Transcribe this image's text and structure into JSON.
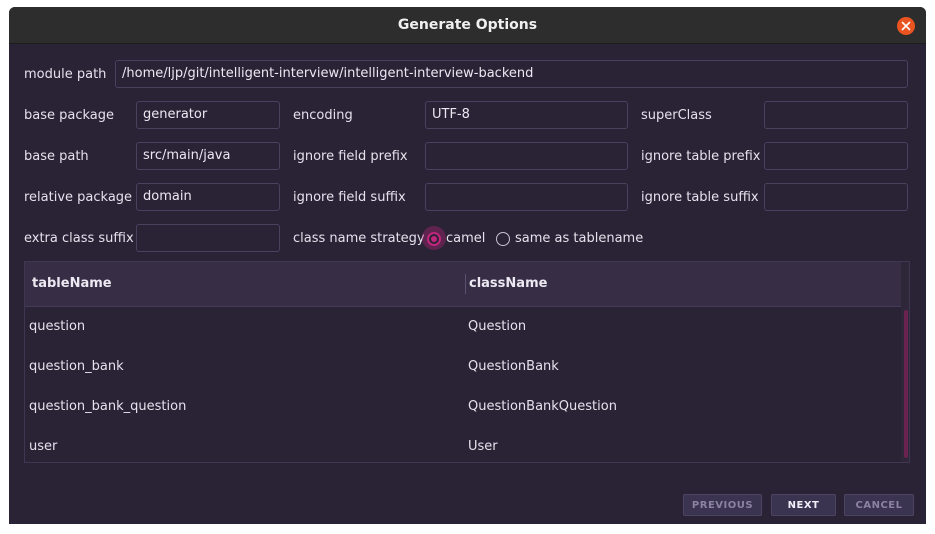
{
  "window": {
    "title": "Generate Options",
    "close_icon": "close-icon",
    "accent": "#e95420"
  },
  "form": {
    "module_path_label": "module path",
    "module_path_value": "/home/ljp/git/intelligent-interview/intelligent-interview-backend",
    "base_package_label": "base package",
    "base_package_value": "generator",
    "base_path_label": "base path",
    "base_path_value": "src/main/java",
    "relative_package_label": "relative package",
    "relative_package_value": "domain",
    "extra_class_suffix_label": "extra class suffix",
    "extra_class_suffix_value": "",
    "encoding_label": "encoding",
    "encoding_value": "UTF-8",
    "ignore_field_prefix_label": "ignore field prefix",
    "ignore_field_prefix_value": "",
    "ignore_field_suffix_label": "ignore field suffix",
    "ignore_field_suffix_value": "",
    "class_name_strategy_label": "class name strategy",
    "strategy_options": [
      {
        "label": "camel",
        "selected": true
      },
      {
        "label": "same as tablename",
        "selected": false
      }
    ],
    "superclass_label": "superClass",
    "superclass_value": "",
    "ignore_table_prefix_label": "ignore table prefix",
    "ignore_table_prefix_value": "",
    "ignore_table_suffix_label": "ignore table suffix",
    "ignore_table_suffix_value": "",
    "radio_accent": "#c0267c"
  },
  "table": {
    "columns": [
      "tableName",
      "className"
    ],
    "rows": [
      {
        "tableName": "question",
        "className": "Question"
      },
      {
        "tableName": "question_bank",
        "className": "QuestionBank"
      },
      {
        "tableName": "question_bank_question",
        "className": "QuestionBankQuestion"
      },
      {
        "tableName": "user",
        "className": "User"
      }
    ]
  },
  "buttons": {
    "previous": "PREVIOUS",
    "next": "NEXT",
    "cancel": "CANCEL"
  }
}
